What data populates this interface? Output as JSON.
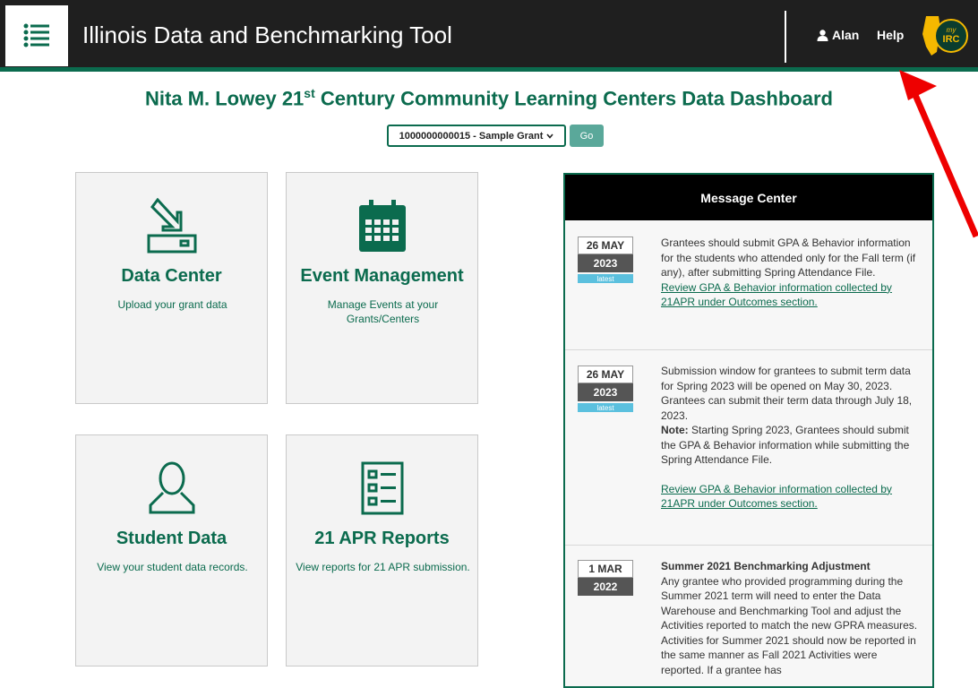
{
  "header": {
    "title": "Illinois Data and Benchmarking Tool",
    "user_name": "Alan",
    "help_label": "Help",
    "logo_text_top": "my",
    "logo_text_bottom": "IRC"
  },
  "page": {
    "title_pre": "Nita M. Lowey 21",
    "title_sup": "st",
    "title_post": " Century Community Learning Centers Data Dashboard",
    "grant_select_value": "1000000000015 - Sample Grant",
    "go_label": "Go"
  },
  "tiles": [
    {
      "icon": "download-icon",
      "title": "Data Center",
      "description": "Upload your grant data"
    },
    {
      "icon": "calendar-icon",
      "title": "Event Management",
      "description": "Manage Events at your Grants/Centers"
    },
    {
      "icon": "user-icon",
      "title": "Student Data",
      "description": "View your student data records."
    },
    {
      "icon": "report-list-icon",
      "title": "21 APR Reports",
      "description": "View reports for 21 APR submission."
    }
  ],
  "message_center": {
    "title": "Message Center",
    "messages": [
      {
        "day_month": "26 MAY",
        "year": "2023",
        "badge": "latest",
        "text": "Grantees should submit GPA & Behavior information for the students who attended only for the Fall term (if any), after submitting Spring Attendance File.",
        "link": "Review GPA & Behavior information collected by 21APR under Outcomes section."
      },
      {
        "day_month": "26 MAY",
        "year": "2023",
        "badge": "latest",
        "text": "Submission window for grantees to submit term data for Spring 2023 will be opened on May 30, 2023. Grantees can submit their term data through July 18, 2023.",
        "note_label": "Note:",
        "note_text": " Starting Spring 2023, Grantees should submit the GPA & Behavior information while submitting the Spring Attendance File.",
        "link": "Review GPA & Behavior information collected by 21APR under Outcomes section."
      },
      {
        "day_month": "1 MAR",
        "year": "2022",
        "heading": "Summer 2021 Benchmarking Adjustment",
        "text": "Any grantee who provided programming during the Summer 2021 term will need to enter the Data Warehouse and Benchmarking Tool and adjust the Activities reported to match the new GPRA measures. Activities for Summer 2021 should now be reported in the same manner as Fall 2021 Activities were reported. If a grantee has"
      }
    ]
  },
  "colors": {
    "brand_green": "#0b6b4e",
    "header_bg": "#1f1f1f",
    "annotation_arrow": "#ee0000"
  }
}
